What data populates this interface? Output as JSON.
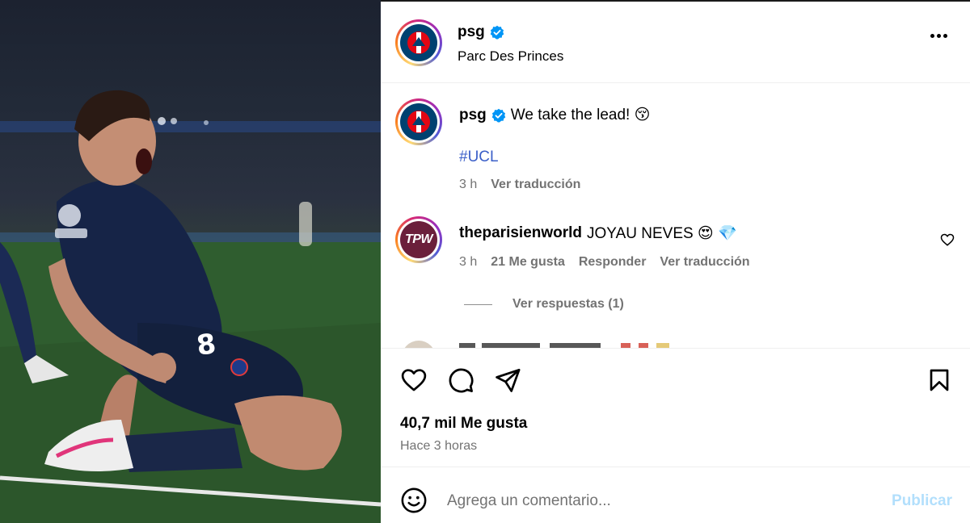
{
  "photo": {
    "description_icon": "photo",
    "jersey_number": "8"
  },
  "post": {
    "account": {
      "username": "psg",
      "verified_icon": "verified-badge-icon",
      "location": "Parc Des Princes"
    },
    "caption": {
      "username": "psg",
      "text": "We take the lead! 😚",
      "hashtag": "#UCL",
      "time": "3 h",
      "translate": "Ver traducción"
    },
    "comments": [
      {
        "username": "theparisienworld",
        "text": "JOYAU NEVES 😍 💎",
        "avatar_text": "TPW",
        "time": "3 h",
        "likes": "21 Me gusta",
        "reply": "Responder",
        "translate": "Ver traducción",
        "view_replies": "Ver respuestas (1)"
      }
    ],
    "likes_count": "40,7 mil Me gusta",
    "posted_ago": "Hace 3 horas",
    "composer": {
      "placeholder": "Agrega un comentario...",
      "publish": "Publicar"
    }
  },
  "colors": {
    "accent_link": "#3b5fc8",
    "publish_disabled": "#b2dffc",
    "secondary_text": "#737373",
    "verified": "#0095f6",
    "psg_navy": "#004170"
  }
}
